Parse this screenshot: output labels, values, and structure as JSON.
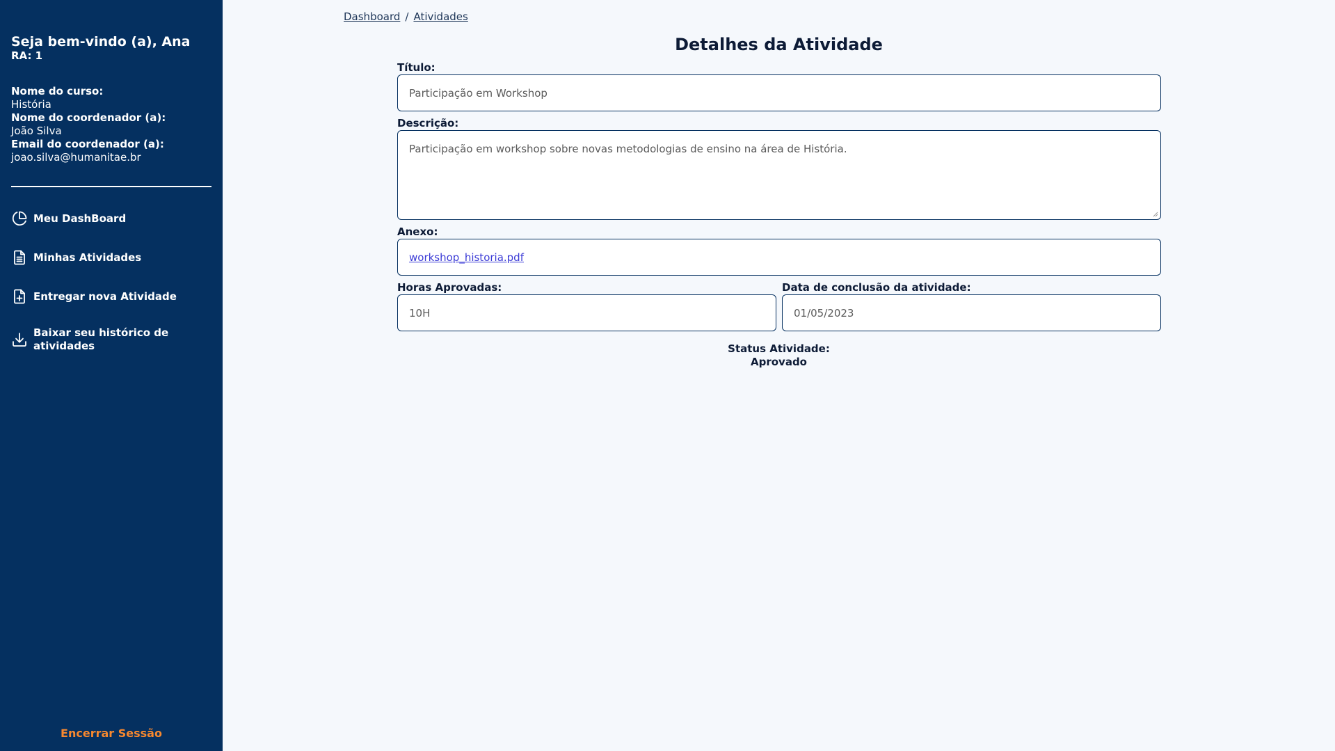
{
  "sidebar": {
    "welcome": "Seja bem-vindo (a), Ana",
    "ra": "RA: 1",
    "course_label": "Nome do curso:",
    "course_value": "História",
    "coordinator_label": "Nome do coordenador (a):",
    "coordinator_value": "João Silva",
    "coordinator_email_label": "Email do coordenador (a):",
    "coordinator_email_value": "joao.silva@humanitae.br",
    "nav": {
      "dashboard": "Meu DashBoard",
      "activities": "Minhas Atividades",
      "new_activity": "Entregar nova Atividade",
      "history": "Baixar seu histórico de atividades"
    },
    "logout": "Encerrar Sessão",
    "icons": [
      "pie-chart-icon",
      "document-icon",
      "document-add-icon",
      "download-icon"
    ]
  },
  "breadcrumb": {
    "home": "Dashboard",
    "separator": "/",
    "current": "Atividades"
  },
  "page_title": "Detalhes da Atividade",
  "form": {
    "titulo_label": "Título:",
    "titulo_value": "Participação em Workshop",
    "descricao_label": "Descrição:",
    "descricao_value": "Participação em workshop sobre novas metodologias de ensino na área de História.",
    "anexo_label": "Anexo:",
    "anexo_value": "workshop_historia.pdf",
    "horas_label": "Horas Aprovadas:",
    "horas_value": "10H",
    "data_label": "Data de conclusão da atividade:",
    "data_value": "01/05/2023"
  },
  "status": {
    "label": "Status Atividade:",
    "value": "Aprovado"
  },
  "colors": {
    "sidebar_bg": "#053060",
    "logout": "#f7882f",
    "page_bg": "#f5f8fc",
    "link": "#3b3bd6"
  }
}
